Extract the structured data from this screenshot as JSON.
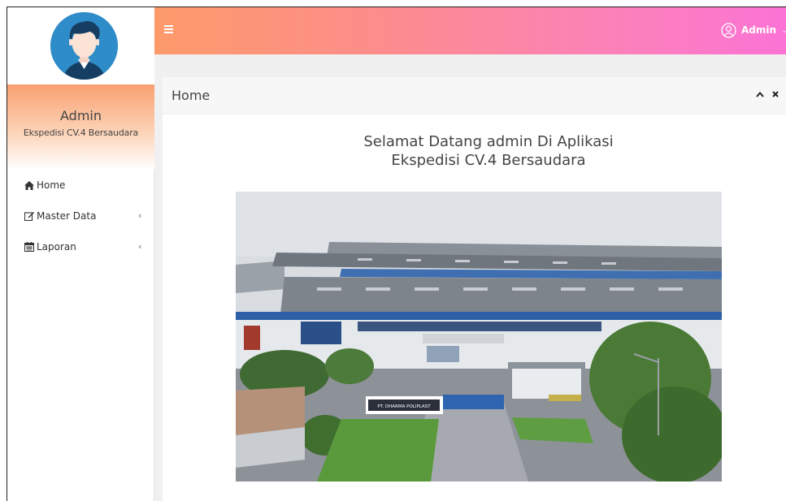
{
  "sidebar": {
    "user_name": "Admin",
    "company": "Ekspedisi CV.4 Bersaudara",
    "menu": [
      {
        "label": "Home",
        "icon": "home-icon",
        "has_submenu": false
      },
      {
        "label": "Master Data",
        "icon": "edit-icon",
        "has_submenu": true
      },
      {
        "label": "Laporan",
        "icon": "calendar-icon",
        "has_submenu": true
      }
    ]
  },
  "header": {
    "menu_toggle_icon": "hamburger-icon",
    "user_label": "Admin",
    "user_icon": "user-circle-icon",
    "gradient_colors": [
      "#fd9a6a",
      "#fb73d5"
    ]
  },
  "panel": {
    "title": "Home",
    "tools": [
      "collapse-icon",
      "close-icon"
    ],
    "welcome_line1": "Selamat Datang admin Di Aplikasi",
    "welcome_line2": "Ekspedisi CV.4 Bersaudara",
    "photo_sign": "PT. DHARMA POLIPLAST"
  },
  "colors": {
    "sidebar_accent": "#f9a071",
    "avatar_bg": "#2e8cc8",
    "panel_header_bg": "#f7f7f7"
  }
}
